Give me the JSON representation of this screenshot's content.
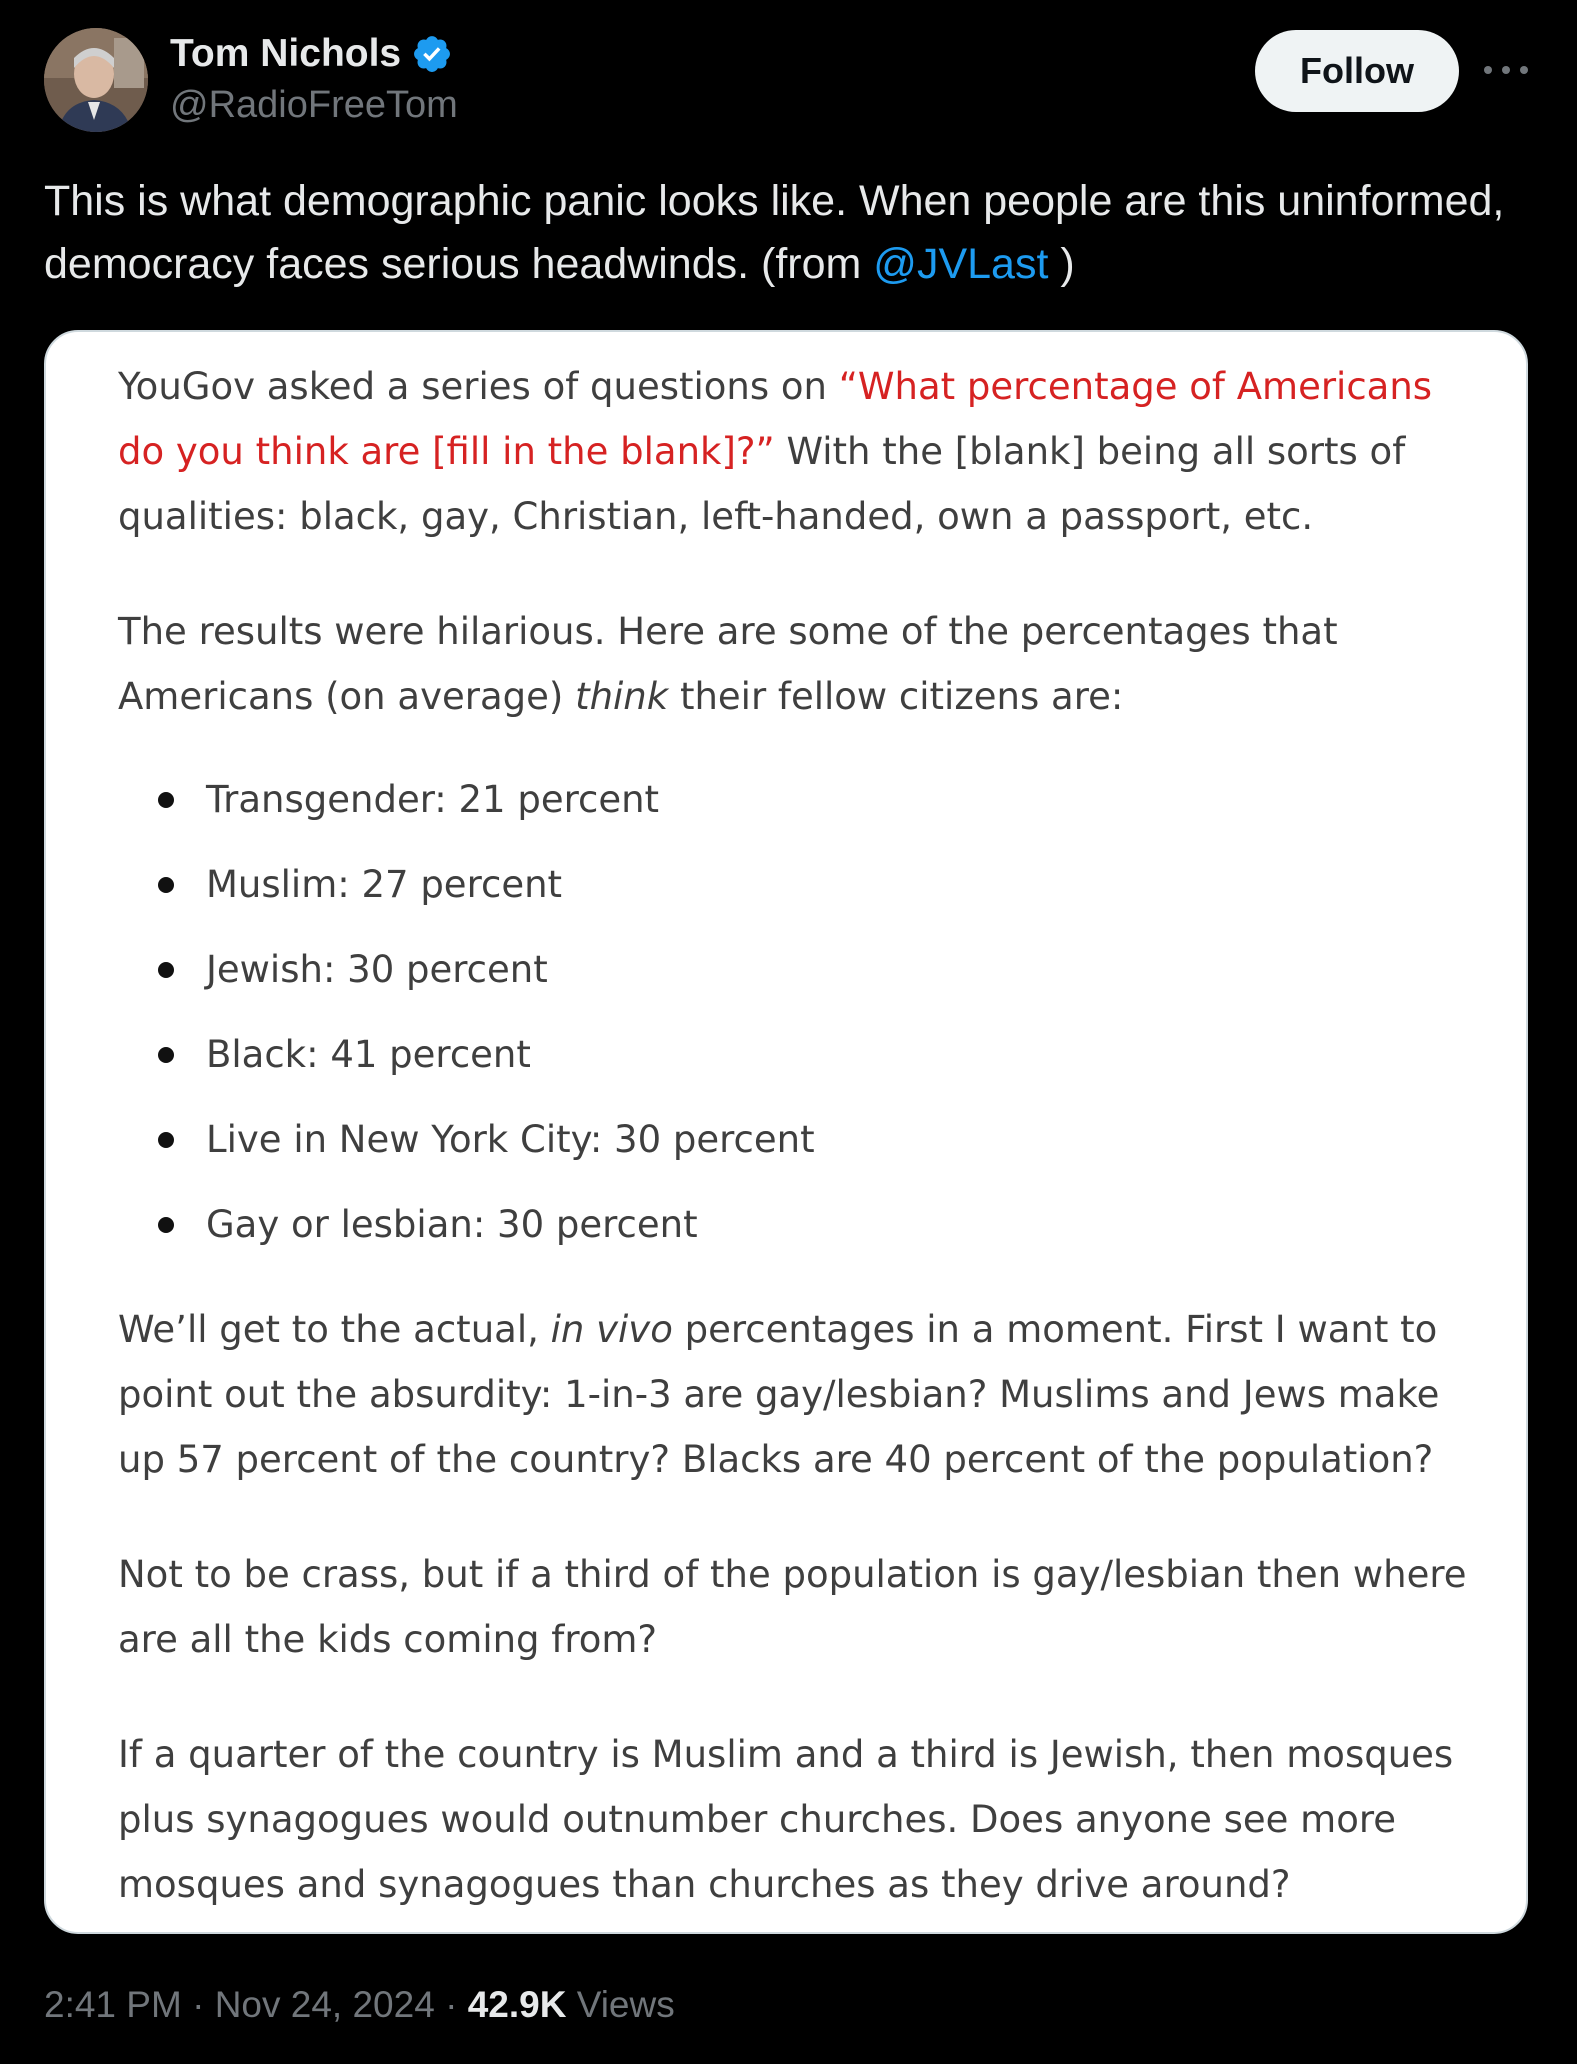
{
  "author": {
    "display_name": "Tom Nichols",
    "handle": "@RadioFreeTom",
    "verified": true,
    "avatar_icon": "user-avatar-photo"
  },
  "follow_label": "Follow",
  "more_icon": "ellipsis-icon",
  "tweet": {
    "text_before": "This is what demographic panic looks like. When people are this uninformed, democracy faces serious headwinds. (from ",
    "mention": "@JVLast",
    "text_after": " )"
  },
  "embed": {
    "p1_start": "YouGov asked a series of questions on ",
    "p1_red": "“What percentage of Americans do you think are [fill in the blank]?”",
    "p1_end": " With the [blank] being all sorts of qualities: black, gay, Christian, left-handed, own a passport, etc.",
    "p2_start": "The results were hilarious. Here are some of the percentages that Americans (on average) ",
    "p2_em": "think",
    "p2_end": " their fellow citizens are:",
    "bullets": [
      "Transgender: 21 percent",
      "Muslim: 27 percent",
      "Jewish: 30 percent",
      "Black: 41 percent",
      "Live in New York City: 30 percent",
      "Gay or lesbian: 30 percent"
    ],
    "p3_start": "We’ll get to the actual, ",
    "p3_em": "in vivo",
    "p3_end": " percentages in a moment. First I want to point out the absurdity: 1-in-3 are gay/lesbian? Muslims and Jews make up 57 percent of the country? Blacks are 40 percent of the population?",
    "p4": "Not to be crass, but if a third of the population is gay/lesbian then where are all the kids coming from?",
    "p5": "If a quarter of the country is Muslim and a third is Jewish, then mosques plus synagogues would outnumber churches. Does anyone see more mosques and synagogues than churches as they drive around?"
  },
  "meta": {
    "time": "2:41 PM",
    "date": "Nov 24, 2024",
    "views_count": "42.9K",
    "views_label": "Views"
  },
  "colors": {
    "background": "#000000",
    "link": "#1d9bf0",
    "verified": "#1d9bf0",
    "highlight_red": "#d62222"
  }
}
